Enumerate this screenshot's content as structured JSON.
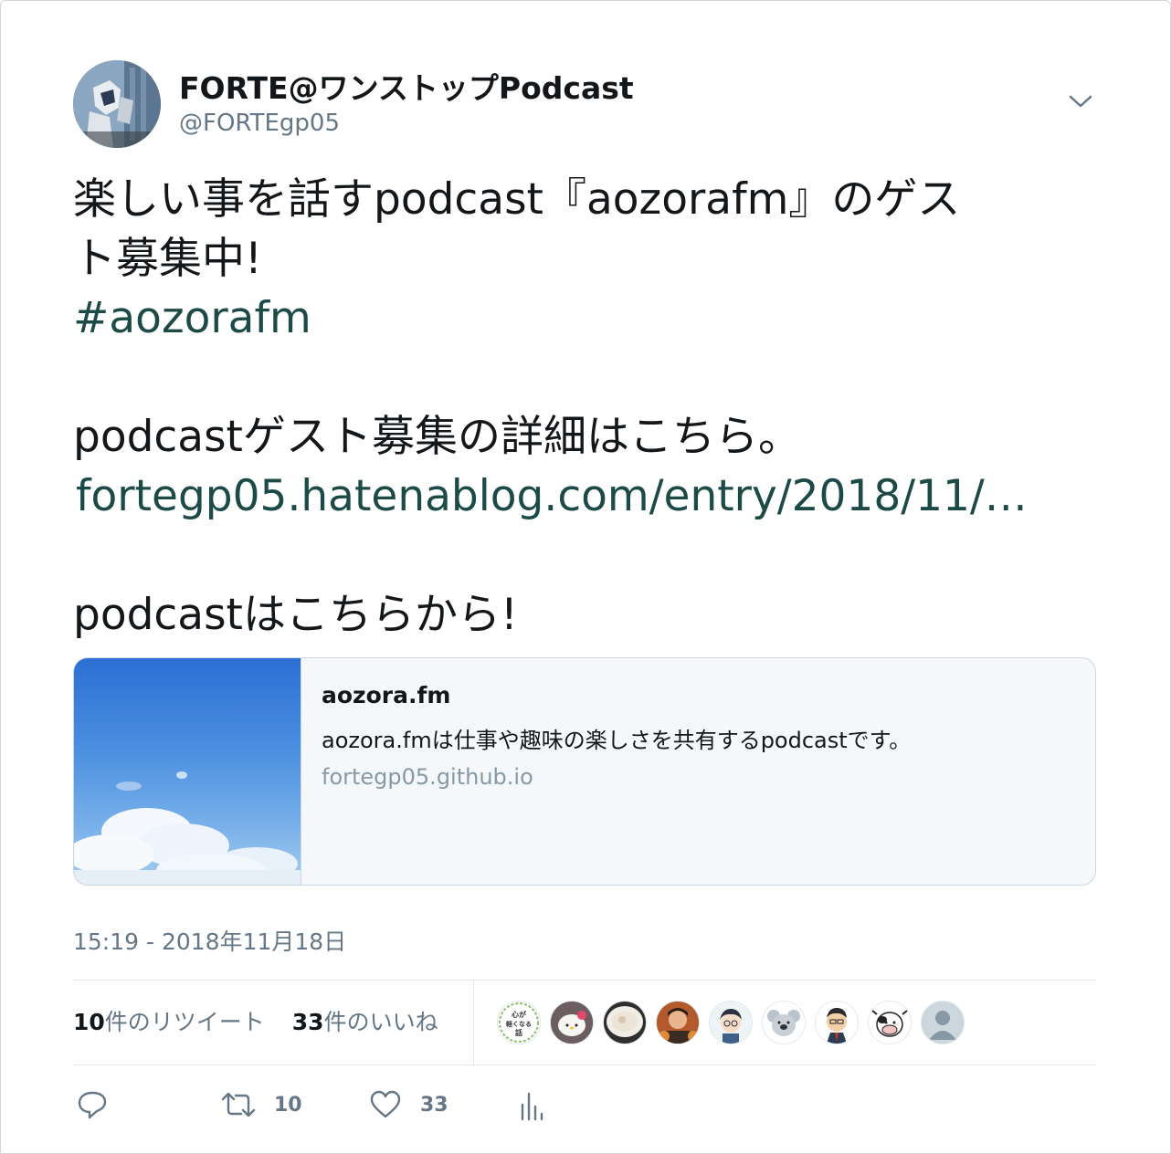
{
  "tweet": {
    "author_name": "FORTE@ワンストップPodcast",
    "author_handle": "@FORTEgp05",
    "text_line1": "楽しい事を話すpodcast『aozorafm』のゲス",
    "text_line2": "ト募集中!",
    "hashtag": "#aozorafm",
    "text_line3": "podcastゲスト募集の詳細はこちら。",
    "link": "fortegp05.hatenablog.com/entry/2018/11/…",
    "text_line4": "podcastはこちらから!",
    "timestamp": "15:19 - 2018年11月18日"
  },
  "card": {
    "title": "aozora.fm",
    "description": "aozora.fmは仕事や趣味の楽しさを共有するpodcastです。",
    "domain": "fortegp05.github.io"
  },
  "stats": {
    "retweets_count": "10",
    "retweets_label": "件のリツイート",
    "likes_count": "33",
    "likes_label": "件のいいね"
  },
  "actions": {
    "retweet_count": "10",
    "like_count": "33"
  },
  "likers": [
    {
      "name": "liker-1",
      "badge": "心が軽くなる話"
    },
    {
      "name": "liker-2"
    },
    {
      "name": "liker-3"
    },
    {
      "name": "liker-4"
    },
    {
      "name": "liker-5"
    },
    {
      "name": "liker-6"
    },
    {
      "name": "liker-7"
    },
    {
      "name": "liker-8"
    },
    {
      "name": "liker-9"
    }
  ],
  "colors": {
    "link": "#1c4a47",
    "secondary": "#657786",
    "card_bg": "#f5f8fa",
    "border": "#ccd6dd"
  }
}
